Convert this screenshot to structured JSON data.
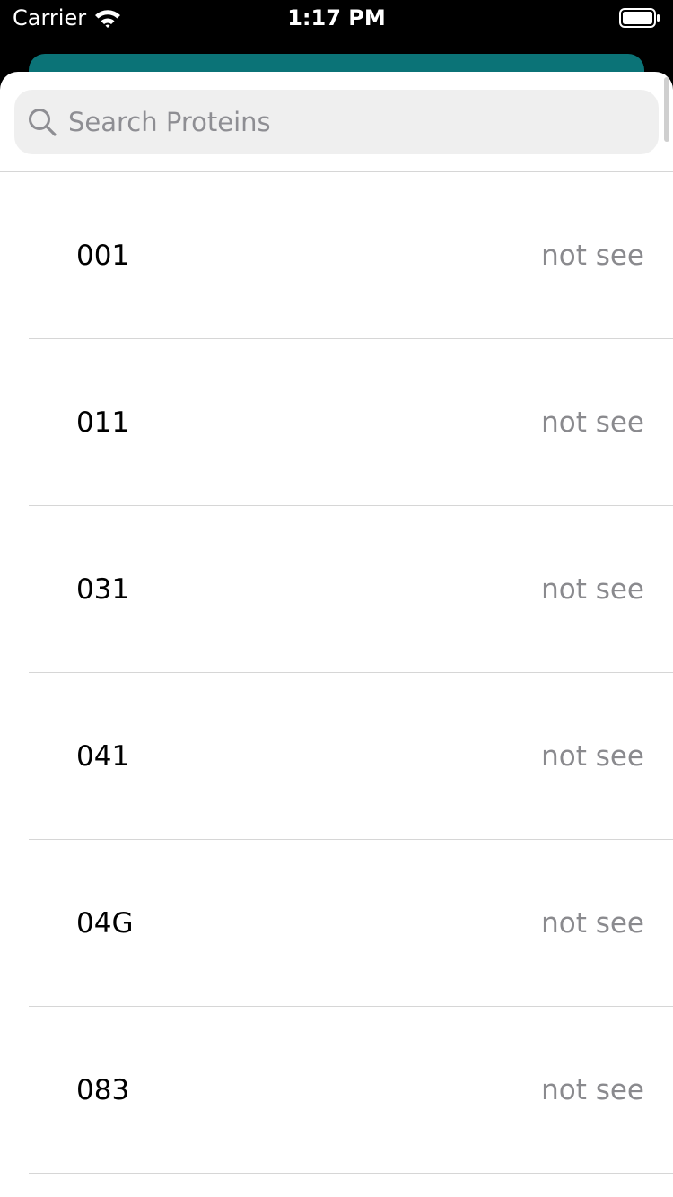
{
  "status_bar": {
    "carrier": "Carrier",
    "time": "1:17 PM",
    "icons": [
      "wifi-icon",
      "battery-icon"
    ]
  },
  "accent_color": "#0b7377",
  "search": {
    "placeholder": "Search Proteins",
    "value": "",
    "icon": "search-icon"
  },
  "proteins": [
    {
      "name": "001",
      "status": "not see"
    },
    {
      "name": "011",
      "status": "not see"
    },
    {
      "name": "031",
      "status": "not see"
    },
    {
      "name": "041",
      "status": "not see"
    },
    {
      "name": "04G",
      "status": "not see"
    },
    {
      "name": "083",
      "status": "not see"
    }
  ]
}
